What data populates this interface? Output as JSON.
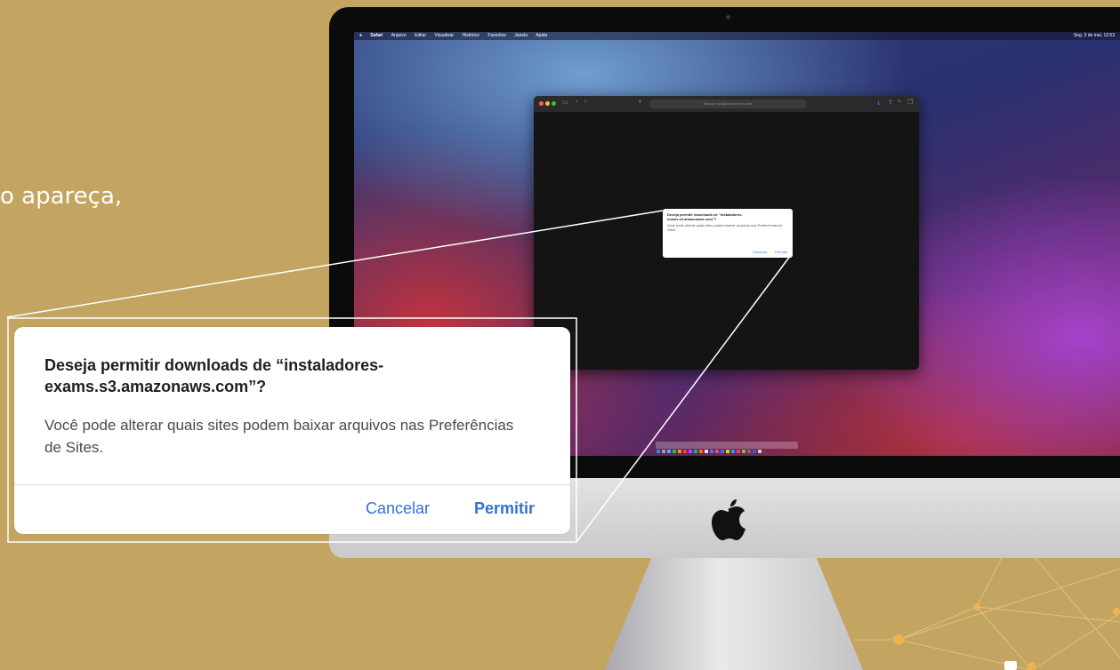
{
  "slide": {
    "text": "o apareça,"
  },
  "mac_menubar": {
    "app": "Safari",
    "items": [
      "Arquivo",
      "Editar",
      "Visualizar",
      "Histórico",
      "Favoritos",
      "Janela",
      "Ajuda"
    ],
    "clock": "Seg. 3 de mai. 12:53"
  },
  "safari": {
    "address_placeholder": "Buscar ou digitar nome do site"
  },
  "dialog": {
    "title": "Deseja permitir downloads de “instaladores-exams.s3.amazonaws.com”?",
    "message": "Você pode alterar quais sites podem baixar arquivos nas Preferências de Sites.",
    "cancel_label": "Cancelar",
    "allow_label": "Permitir"
  },
  "colors": {
    "background": "#c3a460",
    "accent_blue": "#2f72d8"
  }
}
